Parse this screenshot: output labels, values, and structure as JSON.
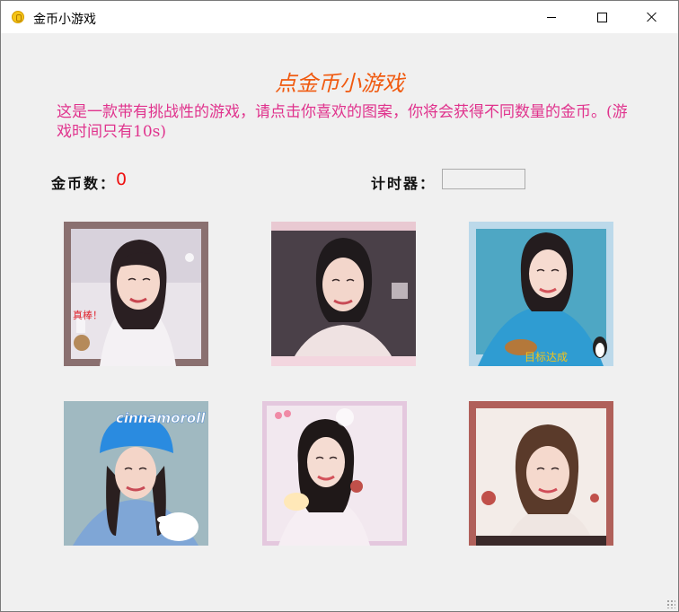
{
  "window": {
    "title": "金币小游戏"
  },
  "main": {
    "heading": "点金币小游戏",
    "description": "这是一款带有挑战性的游戏，请点击你喜欢的图案，你将会获得不同数量的金币。(游戏时间只有10s)",
    "coin_label": "金币数：",
    "coin_value": "0",
    "timer_label": "计时器：",
    "timer_value": ""
  },
  "tiles": [
    {
      "name": "photo-tile-1",
      "caption": "真棒！"
    },
    {
      "name": "photo-tile-2",
      "caption": ""
    },
    {
      "name": "photo-tile-3",
      "caption": "目标达成"
    },
    {
      "name": "photo-tile-4",
      "caption": "cinnamoroll"
    },
    {
      "name": "photo-tile-5",
      "caption": ""
    },
    {
      "name": "photo-tile-6",
      "caption": ""
    }
  ],
  "colors": {
    "heading": "#f05a10",
    "description": "#e0338d",
    "coin_value": "#e11111"
  }
}
